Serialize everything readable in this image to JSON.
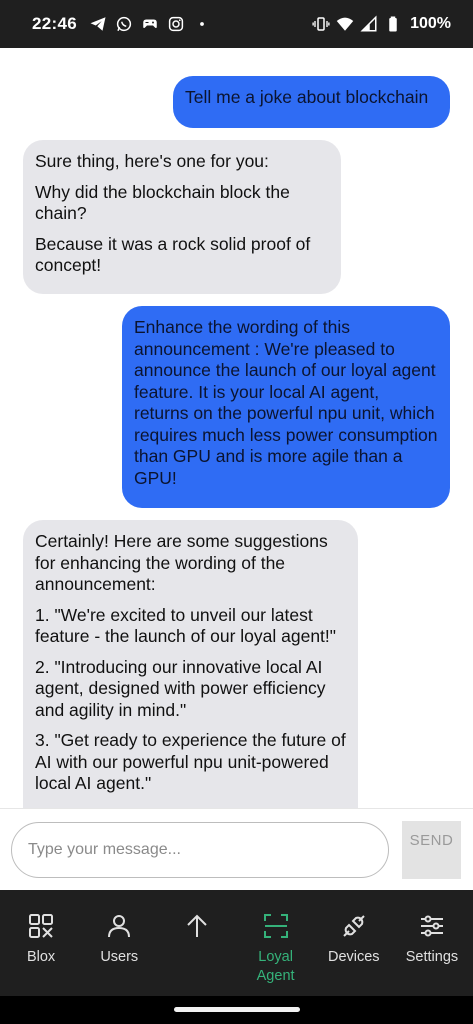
{
  "status_bar": {
    "time": "22:46",
    "left_icons": [
      "telegram-icon",
      "whatsapp-icon",
      "game-controller-icon",
      "instagram-icon",
      "dot-icon"
    ],
    "right_icons": [
      "vibrate-icon",
      "wifi-icon",
      "cellular-signal-icon",
      "battery-icon"
    ],
    "battery": "100%"
  },
  "messages": [
    {
      "sender": "user",
      "paragraphs": [
        "Tell me a joke about blockchain"
      ]
    },
    {
      "sender": "bot",
      "paragraphs": [
        "Sure thing, here's one for you:",
        "Why did the blockchain block the chain?",
        "Because it was a rock solid proof of concept!"
      ]
    },
    {
      "sender": "user",
      "paragraphs": [
        "Enhance the wording of this announcement : We're pleased to announce the launch of our loyal agent feature. It is your local AI agent, returns on the powerful npu unit, which requires much less power consumption than GPU and is more agile than a GPU!"
      ]
    },
    {
      "sender": "bot",
      "paragraphs": [
        "Certainly! Here are some suggestions for enhancing the wording of the announcement:",
        "1. \"We're excited to unveil our latest feature - the launch of our loyal agent!\"",
        "2. \"Introducing our innovative local AI agent, designed with power efficiency and agility in mind.\"",
        "3. \"Get ready to experience the future of AI with our powerful npu unit-powered local AI agent.\""
      ]
    }
  ],
  "composer": {
    "placeholder": "Type your message...",
    "send_label": "SEND"
  },
  "nav": {
    "items": [
      {
        "label": "Blox",
        "icon": "blox-grid-icon",
        "active": false
      },
      {
        "label": "Users",
        "icon": "user-icon",
        "active": false
      },
      {
        "label": "",
        "icon": "arrow-up-icon",
        "active": false
      },
      {
        "label": "Loyal Agent",
        "icon": "scan-frame-icon",
        "active": true
      },
      {
        "label": "Devices",
        "icon": "plug-icon",
        "active": false
      },
      {
        "label": "Settings",
        "icon": "sliders-icon",
        "active": false
      }
    ]
  },
  "colors": {
    "user_bubble": "#2f6cf4",
    "bot_bubble": "#e6e6ea",
    "nav_active": "#35b27a",
    "bars": "#1f1f1f"
  }
}
